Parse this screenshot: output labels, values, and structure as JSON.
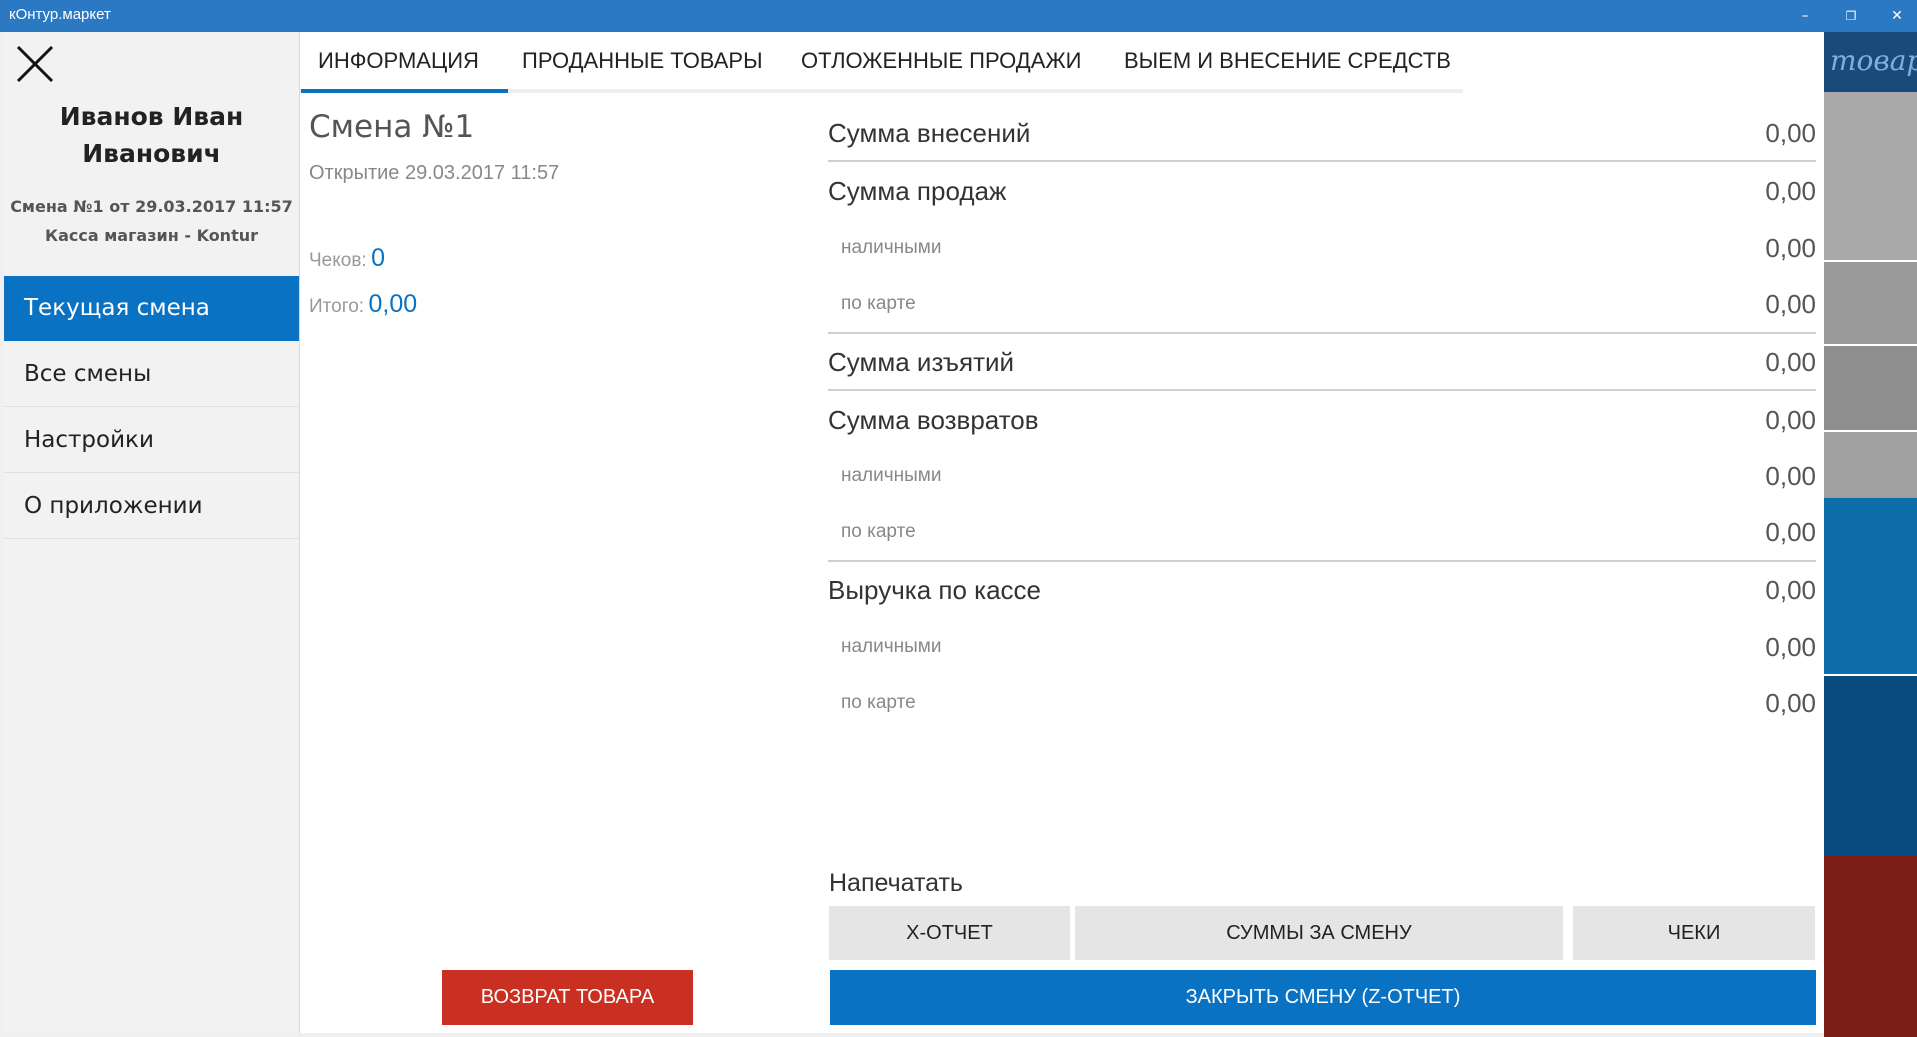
{
  "titlebar": {
    "app_title": "кОнтур.маркет",
    "minimize_glyph": "–",
    "restore_glyph": "❐",
    "close_glyph": "✕"
  },
  "background_app": {
    "partial_text": "товары"
  },
  "sidebar": {
    "user_name_line1": "Иванов Иван",
    "user_name_line2": "Иванович",
    "shift_info": "Смена №1 от 29.03.2017 11:57",
    "register_info": "Касса магазин - Kontur",
    "items": [
      {
        "label": "Текущая смена",
        "active": true
      },
      {
        "label": "Все смены",
        "active": false
      },
      {
        "label": "Настройки",
        "active": false
      },
      {
        "label": "О приложении",
        "active": false
      }
    ]
  },
  "tabs": [
    {
      "label": "ИНФОРМАЦИЯ",
      "active": true
    },
    {
      "label": "ПРОДАННЫЕ ТОВАРЫ",
      "active": false
    },
    {
      "label": "ОТЛОЖЕННЫЕ ПРОДАЖИ",
      "active": false
    },
    {
      "label": "ВЫЕМ И ВНЕСЕНИЕ СРЕДСТВ",
      "active": false
    }
  ],
  "shift": {
    "title": "Смена №1",
    "opened": "Открытие 29.03.2017 11:57",
    "checks_label": "Чеков:",
    "checks_value": "0",
    "total_label": "Итого:",
    "total_value": "0,00"
  },
  "summary": {
    "deposits": {
      "label": "Сумма внесений",
      "value": "0,00"
    },
    "sales": {
      "label": "Сумма продаж",
      "value": "0,00"
    },
    "sales_cash": {
      "label": "наличными",
      "value": "0,00"
    },
    "sales_card": {
      "label": "по карте",
      "value": "0,00"
    },
    "withdrawals": {
      "label": "Сумма изъятий",
      "value": "0,00"
    },
    "returns": {
      "label": "Сумма возвратов",
      "value": "0,00"
    },
    "returns_cash": {
      "label": "наличными",
      "value": "0,00"
    },
    "returns_card": {
      "label": "по карте",
      "value": "0,00"
    },
    "revenue": {
      "label": "Выручка по кассе",
      "value": "0,00"
    },
    "revenue_cash": {
      "label": "наличными",
      "value": "0,00"
    },
    "revenue_card": {
      "label": "по карте",
      "value": "0,00"
    }
  },
  "print": {
    "label": "Напечатать",
    "x_report": "Х-ОТЧЕТ",
    "shift_sums": "СУММЫ ЗА СМЕНУ",
    "checks": "ЧЕКИ"
  },
  "actions": {
    "close_shift": "ЗАКРЫТЬ СМЕНУ (Z-ОТЧЕТ)",
    "return_goods": "ВОЗВРАТ ТОВАРА"
  },
  "colors": {
    "accent": "#0a72c3",
    "titlebar": "#2b79c2",
    "danger": "#c93022"
  }
}
